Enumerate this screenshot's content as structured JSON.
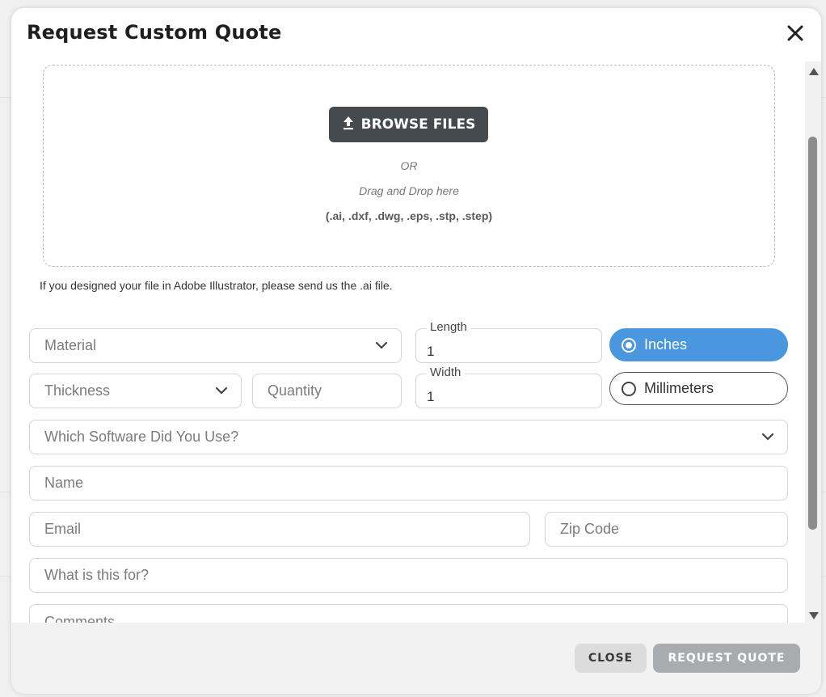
{
  "modal": {
    "title": "Request Custom Quote"
  },
  "upload": {
    "browse_label": "BROWSE FILES",
    "or_text": "OR",
    "drag_text": "Drag and Drop here",
    "formats": "(.ai, .dxf, .dwg, .eps, .stp, .step)",
    "note": "If you designed your file in Adobe Illustrator, please send us the .ai file."
  },
  "form": {
    "material_placeholder": "Material",
    "thickness_placeholder": "Thickness",
    "quantity_placeholder": "Quantity",
    "length_label": "Length",
    "length_value": "1",
    "width_label": "Width",
    "width_value": "1",
    "units": [
      {
        "label": "Inches",
        "selected": true
      },
      {
        "label": "Millimeters",
        "selected": false
      }
    ],
    "software_placeholder": "Which Software Did You Use?",
    "name_placeholder": "Name",
    "email_placeholder": "Email",
    "zip_placeholder": "Zip Code",
    "purpose_placeholder": "What is this for?",
    "comments_placeholder": "Comments"
  },
  "footer": {
    "close_label": "CLOSE",
    "request_label": "REQUEST QUOTE"
  },
  "colors": {
    "accent": "#4a97e0",
    "browse_button": "#454a4f",
    "request_button_disabled": "#a9acae"
  },
  "icons": {
    "close": "close-icon",
    "upload": "upload-icon",
    "dropdown": "chevron-down-icon"
  }
}
